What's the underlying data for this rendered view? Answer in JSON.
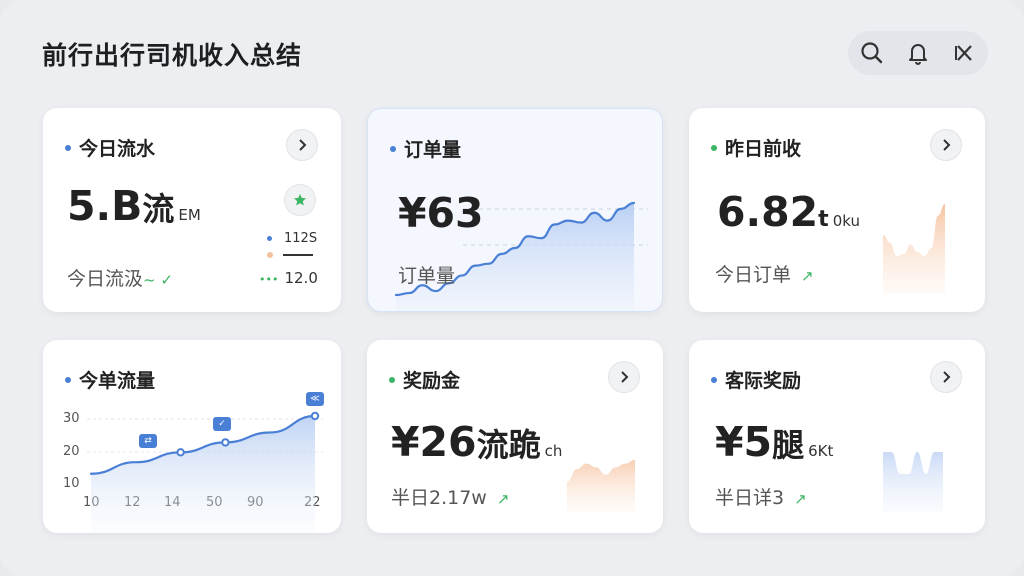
{
  "app": {
    "title": "前行出行司机收入总结"
  },
  "toolbar": {
    "icons": [
      "search-icon",
      "bell-icon",
      "close-icon"
    ]
  },
  "colors": {
    "blue": "#4a7fd6",
    "green": "#3bb563",
    "orange": "#f2a36d",
    "text": "#222222"
  },
  "cards": {
    "c1": {
      "title": "今日流水",
      "value": "5.B",
      "value_cjk": "流",
      "value_suffix": "EM",
      "subtitle": "今日流汲",
      "trend": "~ ✓",
      "legend": {
        "v1": "112S",
        "v2": "12.0"
      },
      "badge_icon": "star-icon"
    },
    "c2": {
      "title": "订单量",
      "value": "¥63",
      "subtitle": "订单量"
    },
    "c3": {
      "title": "昨日前收",
      "value": "6.82",
      "value_suffix": "t",
      "value_suffix2": "0ku",
      "subtitle": "今日订单",
      "trend": "↗"
    },
    "c4": {
      "title": "今单流量",
      "y_ticks": [
        "30",
        "20",
        "10"
      ],
      "x_ticks": [
        "10",
        "12",
        "14",
        "50",
        "90",
        "22"
      ],
      "tags": [
        "⇄",
        "✓",
        "≪"
      ]
    },
    "c5": {
      "title": "奖励金",
      "value": "¥26",
      "value_cjk": "流跪",
      "value_suffix": "ch",
      "subtitle": "半日2.17w",
      "trend": "↗"
    },
    "c6": {
      "title": "客际奖励",
      "value": "¥5",
      "value_cjk": "腿",
      "value_suffix": "6Kt",
      "subtitle": "半日详3",
      "trend": "↗"
    }
  },
  "chart_data": [
    {
      "type": "area",
      "title": "",
      "x": [
        0,
        1,
        2,
        3,
        4,
        5,
        6,
        7,
        8,
        9,
        10,
        11,
        12,
        13,
        14,
        15,
        16,
        17,
        18
      ],
      "series": [
        {
          "values": [
            10,
            12,
            20,
            14,
            22,
            30,
            40,
            42,
            52,
            58,
            70,
            68,
            82,
            86,
            84,
            94,
            86,
            98,
            104
          ]
        }
      ]
    },
    {
      "type": "area",
      "title": "",
      "x": [
        0,
        1,
        2,
        3,
        4,
        5,
        6,
        7,
        8,
        9
      ],
      "series": [
        {
          "values": [
            40,
            32,
            18,
            20,
            30,
            22,
            18,
            26,
            60,
            72
          ]
        }
      ]
    },
    {
      "type": "line",
      "title": "",
      "x": [
        10,
        12,
        14,
        50,
        90,
        22
      ],
      "series": [
        {
          "values": [
            12.5,
            16,
            19,
            22,
            25,
            30
          ]
        }
      ],
      "ylim": [
        10,
        30
      ],
      "y_ticks": [
        10,
        20,
        30
      ]
    },
    {
      "type": "area",
      "title": "",
      "x": [
        0,
        1,
        2,
        3,
        4,
        5,
        6,
        7
      ],
      "series": [
        {
          "values": [
            20,
            34,
            40,
            36,
            28,
            36,
            40,
            44
          ]
        }
      ]
    },
    {
      "type": "area",
      "title": "",
      "x": [
        0,
        1,
        2,
        3,
        4,
        5,
        6,
        7
      ],
      "series": [
        {
          "values": [
            50,
            50,
            20,
            20,
            50,
            20,
            50,
            50
          ]
        }
      ]
    }
  ]
}
